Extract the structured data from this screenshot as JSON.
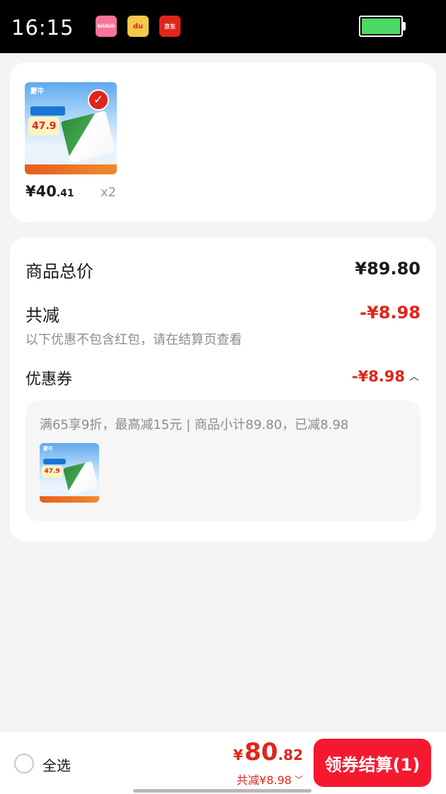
{
  "status_bar": {
    "time": "16:15",
    "apps": [
      "bilibili-icon",
      "du-icon",
      "jd-icon"
    ],
    "app_labels": {
      "bilibili": "bilibili",
      "du": "du",
      "jd": "京东"
    },
    "battery_level": 1.0
  },
  "product": {
    "image_badge_price": "47.9",
    "image_brand": "蒙牛",
    "price_symbol": "¥",
    "price_int": "40",
    "price_dec": ".41",
    "quantity": "x2",
    "selected": true
  },
  "summary": {
    "total_label": "商品总价",
    "total_value": "¥89.80",
    "discount_label": "共减",
    "discount_value": "-¥8.98",
    "hint": "以下优惠不包含红包，请在结算页查看",
    "coupon_label": "优惠券",
    "coupon_value": "-¥8.98",
    "coupon_detail": "满65享9折，最高减15元 | 商品小计89.80，已减8.98"
  },
  "bottom_bar": {
    "select_all_label": "全选",
    "price_symbol": "¥",
    "price_int": "80",
    "price_dec": ".82",
    "saved_label": "共减¥8.98",
    "checkout_label": "领券结算(1)"
  },
  "colors": {
    "accent_red": "#e1251b",
    "checkout_red": "#f5192f",
    "battery_green": "#4cd964"
  }
}
